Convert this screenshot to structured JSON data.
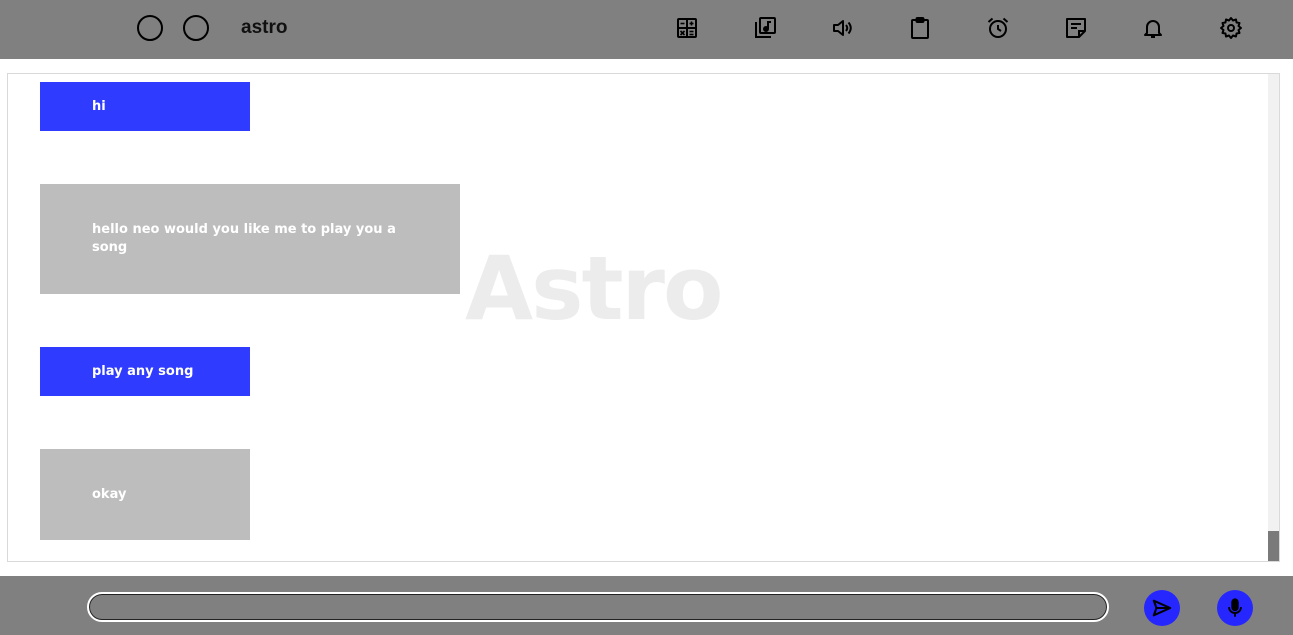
{
  "header": {
    "title": "astro",
    "window_buttons": [
      {
        "name": "circle-button-1"
      },
      {
        "name": "circle-button-2"
      }
    ],
    "icons": [
      {
        "name": "calculator-icon"
      },
      {
        "name": "music-library-icon"
      },
      {
        "name": "volume-icon"
      },
      {
        "name": "clipboard-icon"
      },
      {
        "name": "alarm-icon"
      },
      {
        "name": "sticky-note-icon"
      },
      {
        "name": "bell-icon"
      },
      {
        "name": "settings-gear-icon"
      }
    ]
  },
  "chat": {
    "watermark": "Astro",
    "messages": [
      {
        "sender": "user",
        "text": "hi"
      },
      {
        "sender": "bot",
        "text": "hello neo would you like me to play you a song"
      },
      {
        "sender": "user",
        "text": "play any song"
      },
      {
        "sender": "bot",
        "text": "okay"
      }
    ]
  },
  "composer": {
    "input_value": "",
    "input_placeholder": "",
    "send_icon": "send-icon",
    "mic_icon": "microphone-icon"
  },
  "colors": {
    "bar_gray": "#808080",
    "user_bubble": "#2f3cff",
    "bot_bubble": "#bdbdbd",
    "action_button": "#2626ff"
  }
}
